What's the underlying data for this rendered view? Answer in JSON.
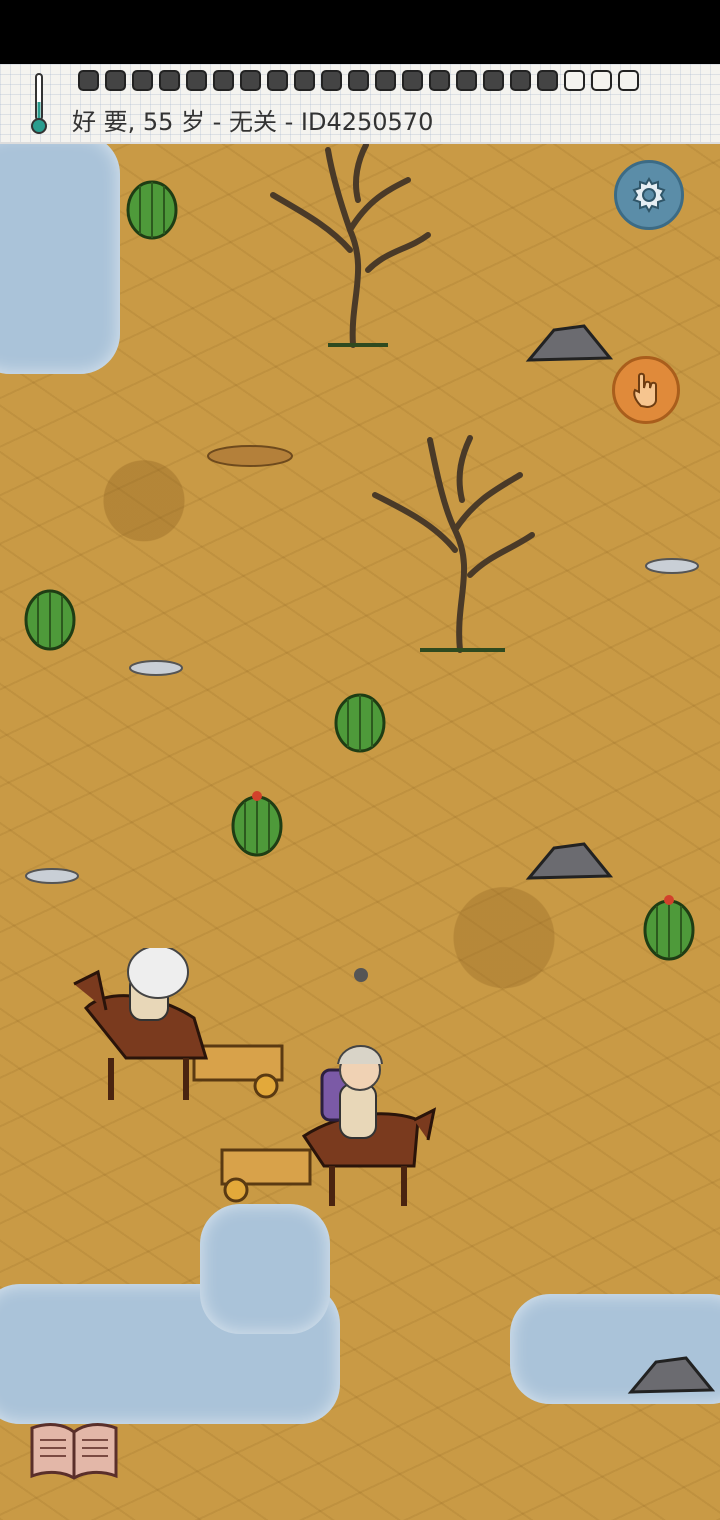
{
  "hud": {
    "player_line": "好 要, 55 岁 - 无关 - ID4250570",
    "food_pips": {
      "filled": 18,
      "total": 21
    }
  },
  "buttons": {
    "settings_icon": "gear-icon",
    "interact_icon": "hand-pointer-icon",
    "book_icon": "open-book-icon"
  },
  "colors": {
    "ground": "#c99a45",
    "water": "#aac3d9",
    "settings_button": "#5b8da8",
    "hand_button": "#e08a3a"
  }
}
